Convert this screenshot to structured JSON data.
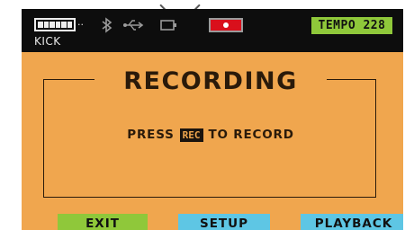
{
  "status": {
    "track_label": "KICK",
    "tempo": "TEMPO 228",
    "battery_icon": "battery-icon",
    "bluetooth_icon": "bluetooth-icon",
    "usb_icon": "usb-icon",
    "sd_card_icon": "sd-card-icon",
    "record_indicator": "record-dot-icon",
    "colors": {
      "tempo_badge": "#8fc83a",
      "record_indicator": "#d9101c"
    }
  },
  "main": {
    "title": "RECORDING",
    "hint_before": "PRESS",
    "hint_key": "REC",
    "hint_after": "TO RECORD"
  },
  "softkeys": {
    "exit": "EXIT",
    "setup": "SETUP",
    "playback": "PLAYBACK"
  },
  "colors": {
    "screen_background": "#f0a64e",
    "status_bar": "#0d0d0d",
    "exit_button": "#8fc83a",
    "setup_button": "#5ec6e4",
    "playback_button": "#5ec6e4"
  }
}
